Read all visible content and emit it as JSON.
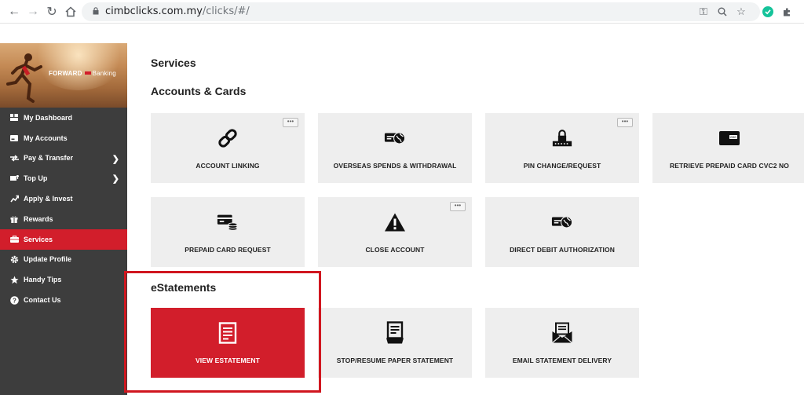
{
  "browser": {
    "url_host": "cimbclicks.com.my",
    "url_path": "/clicks/#/"
  },
  "sidebar": {
    "banner": {
      "brand": "FORWARD",
      "brand2": "Banking"
    },
    "items": [
      {
        "label": "My Dashboard",
        "icon": "dashboard-icon",
        "has_chevron": false,
        "active": false
      },
      {
        "label": "My Accounts",
        "icon": "accounts-icon",
        "has_chevron": false,
        "active": false
      },
      {
        "label": "Pay & Transfer",
        "icon": "transfer-icon",
        "has_chevron": true,
        "active": false
      },
      {
        "label": "Top Up",
        "icon": "topup-icon",
        "has_chevron": true,
        "active": false
      },
      {
        "label": "Apply & Invest",
        "icon": "invest-icon",
        "has_chevron": false,
        "active": false
      },
      {
        "label": "Rewards",
        "icon": "gift-icon",
        "has_chevron": false,
        "active": false
      },
      {
        "label": "Services",
        "icon": "briefcase-icon",
        "has_chevron": false,
        "active": true
      },
      {
        "label": "Update Profile",
        "icon": "gear-icon",
        "has_chevron": false,
        "active": false
      },
      {
        "label": "Handy Tips",
        "icon": "star-icon",
        "has_chevron": false,
        "active": false
      },
      {
        "label": "Contact Us",
        "icon": "help-icon",
        "has_chevron": false,
        "active": false
      }
    ]
  },
  "main": {
    "title": "Services",
    "sections": [
      {
        "title": "Accounts & Cards",
        "cards": [
          {
            "label": "ACCOUNT LINKING",
            "icon": "link-icon",
            "more": true
          },
          {
            "label": "OVERSEAS SPENDS & WITHDRAWAL",
            "icon": "card-globe-icon",
            "more": false
          },
          {
            "label": "PIN CHANGE/REQUEST",
            "icon": "pin-lock-icon",
            "more": true
          },
          {
            "label": "RETRIEVE PREPAID CARD CVC2 NO",
            "icon": "cvc-card-icon",
            "more": false
          },
          {
            "label": "PREPAID CARD REQUEST",
            "icon": "card-coins-icon",
            "more": false
          },
          {
            "label": "CLOSE ACCOUNT",
            "icon": "warning-icon",
            "more": true
          },
          {
            "label": "DIRECT DEBIT AUTHORIZATION",
            "icon": "card-globe-icon",
            "more": false
          }
        ]
      },
      {
        "title": "eStatements",
        "cards": [
          {
            "label": "VIEW ESTATEMENT",
            "icon": "document-icon",
            "more": false
          },
          {
            "label": "STOP/RESUME PAPER STATEMENT",
            "icon": "paper-statement-icon",
            "more": false
          },
          {
            "label": "EMAIL STATEMENT DELIVERY",
            "icon": "email-icon",
            "more": false
          }
        ]
      }
    ],
    "more_label": "•••"
  },
  "colors": {
    "accent": "#d21e2b",
    "sidebar_bg": "#3d3d3d",
    "card_bg": "#eeeeee"
  }
}
